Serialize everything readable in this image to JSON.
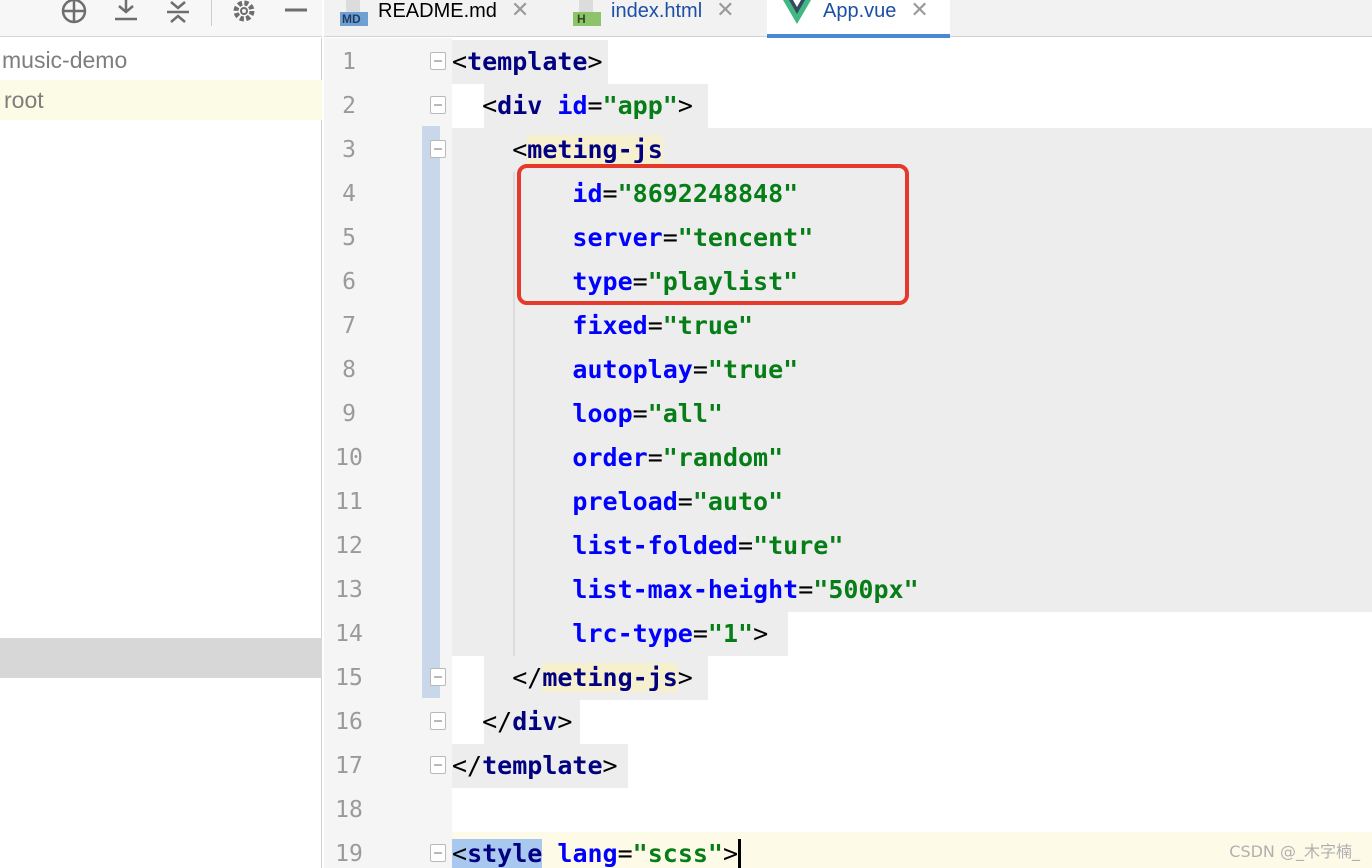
{
  "toolbar": {
    "icons": [
      "locate-icon",
      "expand-all-icon",
      "collapse-all-icon",
      "gear-icon",
      "minimize-icon"
    ]
  },
  "tabs": [
    {
      "label": "README.md",
      "icon_text": "MD",
      "icon": "markdown-file-icon",
      "active": false
    },
    {
      "label": "index.html",
      "icon_text": "H",
      "icon": "html-file-icon",
      "active": false
    },
    {
      "label": "App.vue",
      "icon": "vue-file-icon",
      "active": true
    }
  ],
  "project": {
    "items": [
      "music-demo",
      "root"
    ]
  },
  "editor": {
    "line_numbers": [
      "1",
      "2",
      "3",
      "4",
      "5",
      "6",
      "7",
      "8",
      "9",
      "10",
      "11",
      "12",
      "13",
      "14",
      "15",
      "16",
      "17",
      "18",
      "19"
    ],
    "tokens": {
      "template": "template",
      "div": "div",
      "id_attr": "id",
      "app": "\"app\"",
      "meting": "meting-js",
      "id_val": "\"8692248848\"",
      "server": "server",
      "tencent": "\"tencent\"",
      "type": "type",
      "playlist": "\"playlist\"",
      "fixed": "fixed",
      "true1": "\"true\"",
      "autoplay": "autoplay",
      "true2": "\"true\"",
      "loop": "loop",
      "all": "\"all\"",
      "order": "order",
      "random": "\"random\"",
      "preload": "preload",
      "auto": "\"auto\"",
      "list_folded": "list-folded",
      "ture": "\"ture\"",
      "list_max_height": "list-max-height",
      "px500": "\"500px\"",
      "lrc_type": "lrc-type",
      "one": "\"1\"",
      "style": "style",
      "lang": "lang",
      "scss": "\"scss\""
    }
  },
  "watermark": "CSDN @_木字楠_",
  "colors": {
    "tag": "#000080",
    "attribute": "#0000ff",
    "string": "#067d17",
    "highlight_box": "#e5392b",
    "active_tab_underline": "#4a88d6"
  }
}
